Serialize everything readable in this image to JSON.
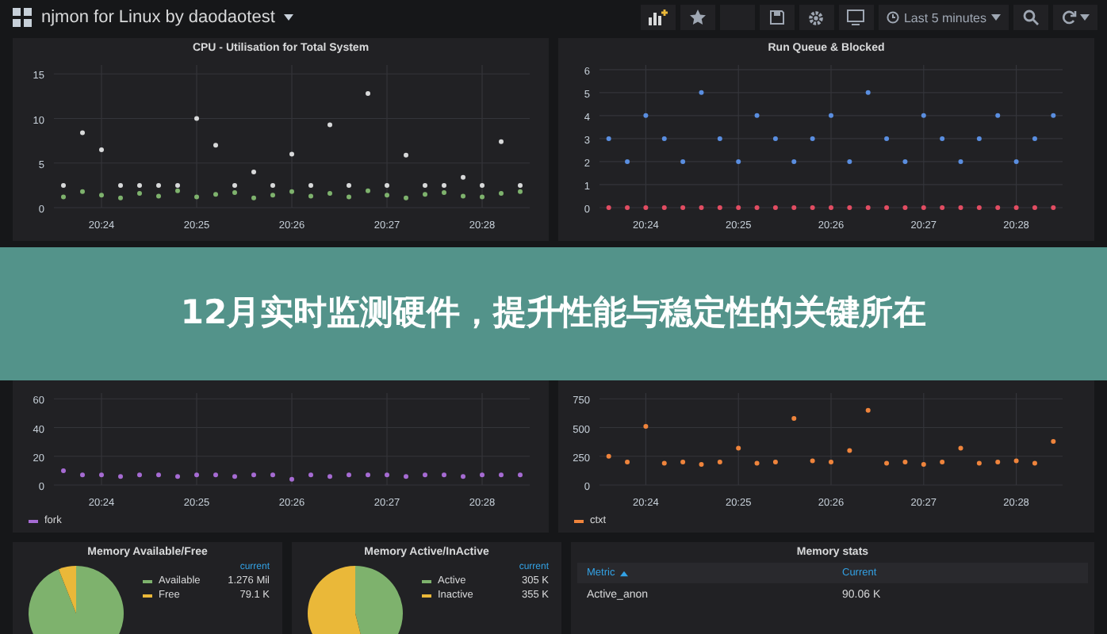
{
  "top_bar": {
    "title": "njmon for Linux by daodaotest",
    "time_range": "Last 5 minutes"
  },
  "banner": {
    "title": "12月实时监测硬件，提升性能与稳定性的关键所在"
  },
  "graph_panels": [
    {
      "title": "CPU - Utilisation for Total System",
      "chart_data": {
        "type": "scatter",
        "grid": true,
        "ylim": [
          0,
          16
        ],
        "yticks": [
          0,
          5,
          10,
          15
        ],
        "categories": [
          null,
          null,
          "20:24",
          null,
          null,
          null,
          null,
          "20:25",
          null,
          null,
          null,
          null,
          "20:26",
          null,
          null,
          null,
          null,
          "20:27",
          null,
          null,
          null,
          null,
          "20:28",
          null,
          null
        ],
        "series": [
          {
            "color": "#7eb26d",
            "values": [
              1.2,
              1.8,
              1.4,
              1.1,
              1.6,
              1.3,
              1.9,
              1.2,
              1.5,
              1.7,
              1.1,
              1.4,
              1.8,
              1.3,
              1.6,
              1.2,
              1.9,
              1.4,
              1.1,
              1.5,
              1.7,
              1.3,
              1.2,
              1.6,
              1.8
            ]
          },
          {
            "color": "#d8d9da",
            "values": [
              2.5,
              8.4,
              6.5,
              2.5,
              2.5,
              2.5,
              2.5,
              10,
              7,
              2.5,
              4,
              2.5,
              6,
              2.5,
              9.3,
              2.5,
              12.8,
              2.5,
              5.9,
              2.5,
              2.5,
              3.4,
              2.5,
              7.4,
              2.5
            ]
          }
        ]
      }
    },
    {
      "title": "Run Queue & Blocked",
      "chart_data": {
        "type": "scatter",
        "grid": true,
        "ylim": [
          0,
          6.2
        ],
        "yticks": [
          0,
          1,
          2,
          3,
          4,
          5,
          6
        ],
        "categories": [
          null,
          null,
          "20:24",
          null,
          null,
          null,
          null,
          "20:25",
          null,
          null,
          null,
          null,
          "20:26",
          null,
          null,
          null,
          null,
          "20:27",
          null,
          null,
          null,
          null,
          "20:28",
          null,
          null
        ],
        "series": [
          {
            "color": "#5a8ee0",
            "values": [
              3,
              2,
              4,
              3,
              2,
              5,
              3,
              2,
              4,
              3,
              2,
              3,
              4,
              2,
              5,
              3,
              2,
              4,
              3,
              2,
              3,
              4,
              2,
              3,
              4
            ]
          },
          {
            "color": "#e24d62",
            "values": [
              0,
              0,
              0,
              0,
              0,
              0,
              0,
              0,
              0,
              0,
              0,
              0,
              0,
              0,
              0,
              0,
              0,
              0,
              0,
              0,
              0,
              0,
              0,
              0,
              0
            ]
          }
        ]
      }
    },
    {
      "chart_data": {
        "type": "scatter",
        "grid": true,
        "ylim": [
          0,
          64
        ],
        "yticks": [
          0,
          20,
          40,
          60
        ],
        "categories": [
          null,
          null,
          "20:24",
          null,
          null,
          null,
          null,
          "20:25",
          null,
          null,
          null,
          null,
          "20:26",
          null,
          null,
          null,
          null,
          "20:27",
          null,
          null,
          null,
          null,
          "20:28",
          null,
          null
        ],
        "series": [
          {
            "name": "fork",
            "color": "#a66bd3",
            "values": [
              10,
              7,
              7,
              6,
              7,
              7,
              6,
              7,
              7,
              6,
              7,
              7,
              4,
              7,
              6,
              7,
              7,
              7,
              6,
              7,
              7,
              6,
              7,
              7,
              7
            ]
          }
        ]
      }
    },
    {
      "chart_data": {
        "type": "scatter",
        "grid": true,
        "ylim": [
          0,
          800
        ],
        "yticks": [
          0,
          250,
          500,
          750
        ],
        "categories": [
          null,
          null,
          "20:24",
          null,
          null,
          null,
          null,
          "20:25",
          null,
          null,
          null,
          null,
          "20:26",
          null,
          null,
          null,
          null,
          "20:27",
          null,
          null,
          null,
          null,
          "20:28",
          null,
          null
        ],
        "series": [
          {
            "name": "ctxt",
            "color": "#ef843c",
            "values": [
              250,
              200,
              510,
              190,
              200,
              180,
              200,
              320,
              190,
              200,
              580,
              210,
              200,
              300,
              650,
              190,
              200,
              180,
              200,
              320,
              190,
              200,
              210,
              190,
              380
            ]
          }
        ]
      }
    }
  ],
  "pie_panels": [
    {
      "title": "Memory Available/Free",
      "column": "current",
      "chart_data": {
        "type": "pie",
        "categories": [
          "Available",
          "Free"
        ],
        "values": [
          0.94,
          0.06
        ],
        "colors": [
          "#7eb26d",
          "#eab839"
        ]
      },
      "readings": [
        "1.276 Mil",
        "79.1 K"
      ]
    },
    {
      "title": "Memory Active/InActive",
      "column": "current",
      "chart_data": {
        "type": "pie",
        "categories": [
          "Active",
          "Inactive"
        ],
        "values": [
          0.46,
          0.54
        ],
        "colors": [
          "#7eb26d",
          "#eab839"
        ]
      },
      "readings": [
        "305 K",
        "355 K"
      ]
    }
  ],
  "table_panel": {
    "title": "Memory stats",
    "columns": [
      {
        "label": "Metric",
        "sorted": true
      },
      {
        "label": "Current",
        "sorted": false
      }
    ],
    "rows": [
      [
        "Active_anon",
        "90.06 K"
      ]
    ]
  }
}
